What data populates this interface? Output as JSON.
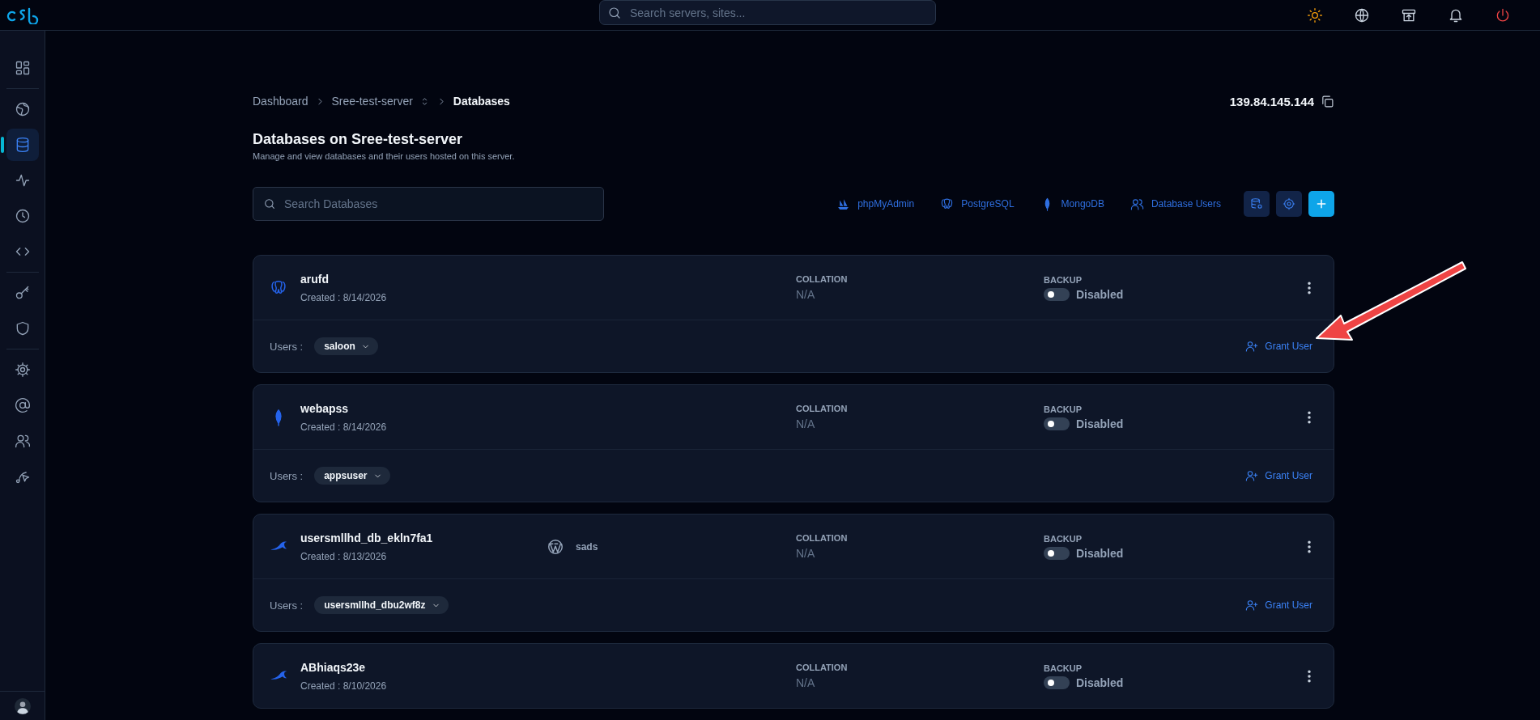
{
  "topbar": {
    "search": {
      "placeholder": "Search servers, sites..."
    }
  },
  "sidebar": {
    "items": [
      {
        "selected": false
      },
      {
        "selected": false
      },
      {
        "selected": true
      },
      {
        "selected": false
      },
      {
        "selected": false
      },
      {
        "selected": false
      },
      {
        "selected": false
      },
      {
        "selected": false
      },
      {
        "selected": false
      },
      {
        "selected": false
      },
      {
        "selected": false
      },
      {
        "selected": false
      }
    ]
  },
  "breadcrumb": [
    "Dashboard",
    "Sree-test-server",
    "Databases"
  ],
  "ip_address": "139.84.145.144",
  "title": "Databases on Sree-test-server",
  "subtitle": "Manage and view databases and their users hosted on this server.",
  "search": {
    "placeholder": "Search Databases"
  },
  "tool_links": [
    "phpMyAdmin",
    "PostgreSQL",
    "MongoDB",
    "Database Users"
  ],
  "databases": [
    {
      "kind": "postgresql",
      "name": "arufd",
      "created": "Created : 8/14/2026",
      "collation_label": "COLLATION",
      "collation": "N/A",
      "backup_label": "BACKUP",
      "backup_on": false,
      "backup_status": "Disabled",
      "users_label": "Users :",
      "user": "saloon",
      "grant": "Grant User"
    },
    {
      "kind": "mongodb",
      "name": "webapss",
      "created": "Created : 8/14/2026",
      "collation_label": "COLLATION",
      "collation": "N/A",
      "backup_label": "BACKUP",
      "backup_on": false,
      "backup_status": "Disabled",
      "users_label": "Users :",
      "user": "appsuser",
      "grant": "Grant User"
    },
    {
      "kind": "mysql",
      "name": "usersmllhd_db_ekln7fa1",
      "site": "sads",
      "created": "Created : 8/13/2026",
      "collation_label": "COLLATION",
      "collation": "N/A",
      "backup_label": "BACKUP",
      "backup_on": false,
      "backup_status": "Disabled",
      "users_label": "Users :",
      "user": "usersmllhd_dbu2wf8z",
      "grant": "Grant User"
    },
    {
      "kind": "mysql",
      "name": "ABhiaqs23e",
      "created": "Created : 8/10/2026",
      "collation_label": "COLLATION",
      "collation": "N/A",
      "backup_label": "BACKUP",
      "backup_on": false,
      "backup_status": "Disabled"
    }
  ]
}
